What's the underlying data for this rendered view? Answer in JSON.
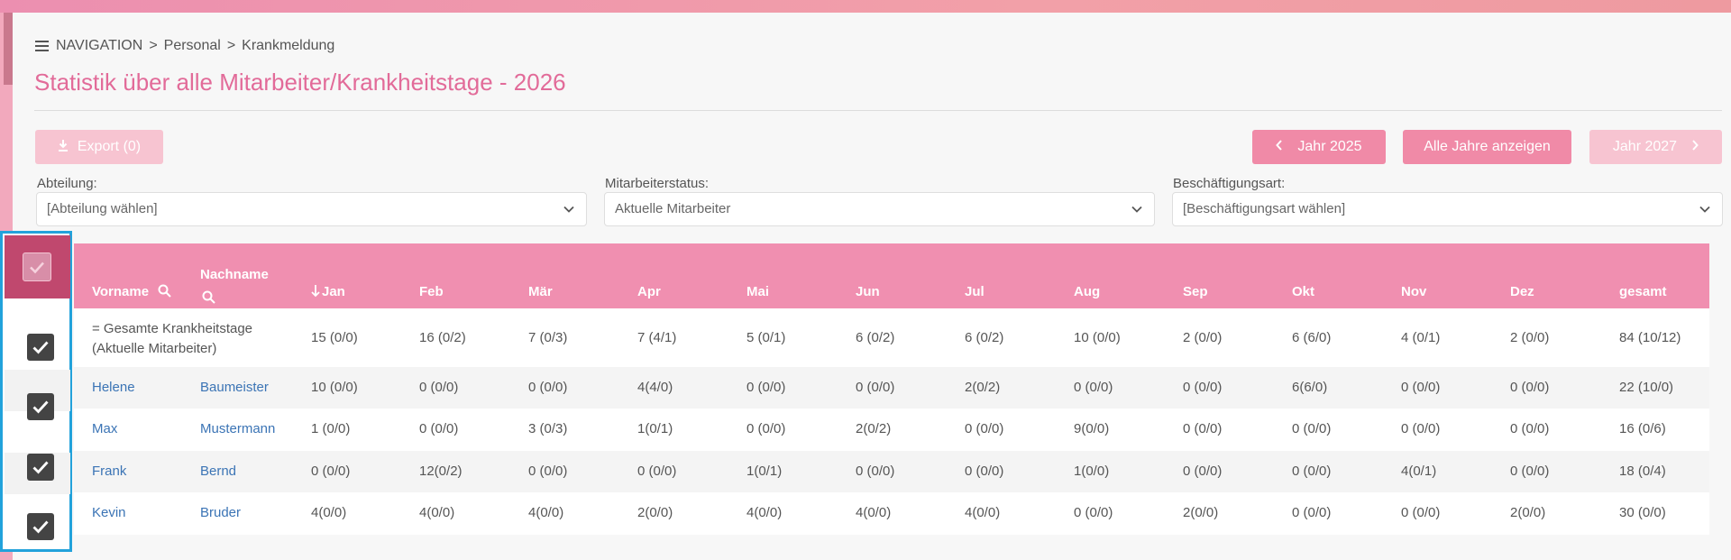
{
  "breadcrumb": {
    "nav": "NAVIGATION",
    "sep": ">",
    "level1": "Personal",
    "level2": "Krankmeldung"
  },
  "page_title": "Statistik über alle Mitarbeiter/Krankheitstage - 2026",
  "toolbar": {
    "export_label": "Export (0)",
    "prev_year_label": "Jahr 2025",
    "all_years_label": "Alle Jahre anzeigen",
    "next_year_label": "Jahr 2027"
  },
  "filters": {
    "abteilung": {
      "label": "Abteilung:",
      "value": "[Abteilung wählen]"
    },
    "status": {
      "label": "Mitarbeiterstatus:",
      "value": "Aktuelle Mitarbeiter"
    },
    "art": {
      "label": "Beschäftigungsart:",
      "value": "[Beschäftigungsart wählen]"
    }
  },
  "table": {
    "headers": {
      "first": "Vorname",
      "last": "Nachname",
      "jan": "Jan",
      "feb": "Feb",
      "mar": "Mär",
      "apr": "Apr",
      "mai": "Mai",
      "jun": "Jun",
      "jul": "Jul",
      "aug": "Aug",
      "sep": "Sep",
      "okt": "Okt",
      "nov": "Nov",
      "dez": "Dez",
      "total": "gesamt"
    },
    "total_row": {
      "label_line1": "= Gesamte Krankheitstage",
      "label_line2": "(Aktuelle Mitarbeiter)",
      "values": [
        "15 (0/0)",
        "16 (0/2)",
        "7 (0/3)",
        "7 (4/1)",
        "5 (0/1)",
        "6 (0/2)",
        "6 (0/2)",
        "10 (0/0)",
        "2 (0/0)",
        "6 (6/0)",
        "4 (0/1)",
        "2 (0/0)",
        "84 (10/12)"
      ]
    },
    "rows": [
      {
        "first": "Helene",
        "last": "Baumeister",
        "values": [
          "10 (0/0)",
          "0 (0/0)",
          "0 (0/0)",
          "4(4/0)",
          "0 (0/0)",
          "0 (0/0)",
          "2(0/2)",
          "0 (0/0)",
          "0 (0/0)",
          "6(6/0)",
          "0 (0/0)",
          "0 (0/0)",
          "22 (10/0)"
        ]
      },
      {
        "first": "Max",
        "last": "Mustermann",
        "values": [
          "1 (0/0)",
          "0 (0/0)",
          "3 (0/3)",
          "1(0/1)",
          "0 (0/0)",
          "2(0/2)",
          "0 (0/0)",
          "9(0/0)",
          "0 (0/0)",
          "0 (0/0)",
          "0 (0/0)",
          "0 (0/0)",
          "16 (0/6)"
        ]
      },
      {
        "first": "Frank",
        "last": "Bernd",
        "values": [
          "0 (0/0)",
          "12(0/2)",
          "0 (0/0)",
          "0 (0/0)",
          "1(0/1)",
          "0 (0/0)",
          "0 (0/0)",
          "1(0/0)",
          "0 (0/0)",
          "0 (0/0)",
          "4(0/1)",
          "0 (0/0)",
          "18 (0/4)"
        ]
      },
      {
        "first": "Kevin",
        "last": "Bruder",
        "values": [
          "4(0/0)",
          "4(0/0)",
          "4(0/0)",
          "2(0/0)",
          "4(0/0)",
          "4(0/0)",
          "4(0/0)",
          "0 (0/0)",
          "2(0/0)",
          "0 (0/0)",
          "0 (0/0)",
          "2(0/0)",
          "30 (0/0)"
        ]
      }
    ]
  },
  "colors": {
    "accent": "#f08fb0",
    "title": "#e26b99",
    "link": "#3b74b5",
    "highlight_border": "#22a2db"
  }
}
